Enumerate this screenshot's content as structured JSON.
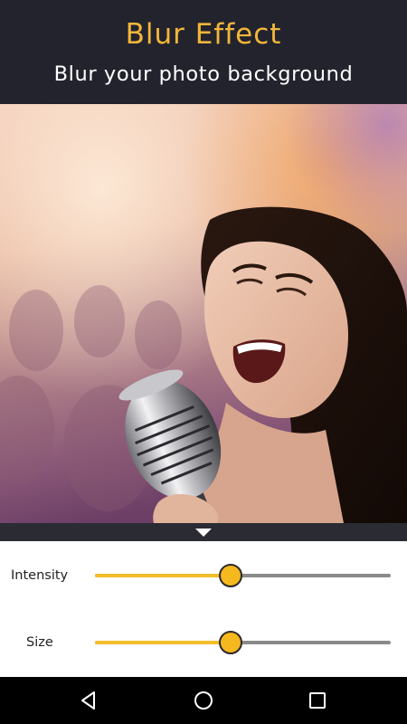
{
  "header": {
    "title": "Blur Effect",
    "subtitle": "Blur your photo background",
    "title_color": "#f3b63a",
    "background_color": "#23232e"
  },
  "photo": {
    "description_icon": "singer-with-microphone-photo"
  },
  "controls": {
    "sliders": [
      {
        "label": "Intensity",
        "value": 0.46
      },
      {
        "label": "Size",
        "value": 0.46
      }
    ],
    "accent_color": "#f6b81f"
  },
  "navbar": {
    "buttons": [
      "back-icon",
      "home-icon",
      "recents-icon"
    ]
  }
}
